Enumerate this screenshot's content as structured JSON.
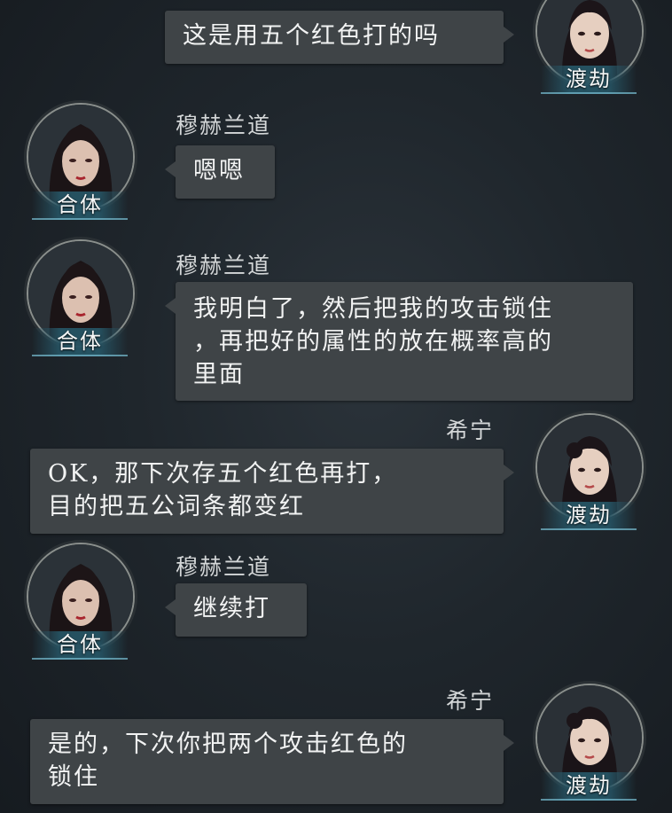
{
  "messages": [
    {
      "side": "right",
      "sender": "",
      "realm": "渡劫",
      "text": "这是用五个红色打的吗"
    },
    {
      "side": "left",
      "sender": "穆赫兰道",
      "realm": "合体",
      "text": "嗯嗯"
    },
    {
      "side": "left",
      "sender": "穆赫兰道",
      "realm": "合体",
      "text": "我明白了，然后把我的攻击锁住\n，再把好的属性的放在概率高的\n里面"
    },
    {
      "side": "right",
      "sender": "希宁",
      "realm": "渡劫",
      "text": "OK，那下次存五个红色再打，\n目的把五公词条都变红"
    },
    {
      "side": "left",
      "sender": "穆赫兰道",
      "realm": "合体",
      "text": "继续打"
    },
    {
      "side": "right",
      "sender": "希宁",
      "realm": "渡劫",
      "text": "是的，下次你把两个攻击红色的\n锁住"
    }
  ],
  "colors": {
    "bubble": "#3f4447",
    "realm_band": "#265464",
    "background": "#1f262c"
  }
}
